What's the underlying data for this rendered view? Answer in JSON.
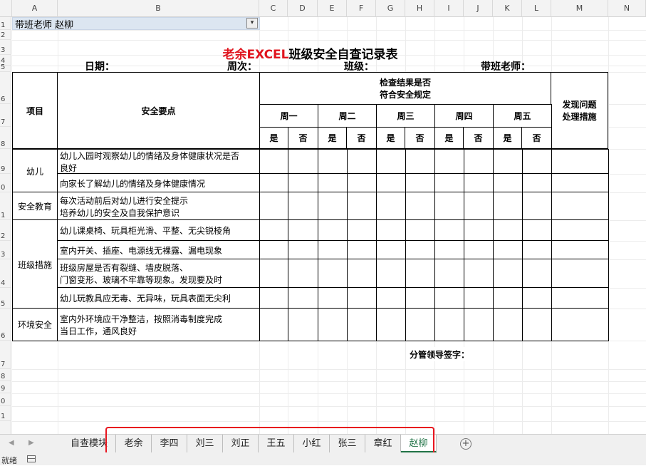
{
  "columns": [
    "A",
    "B",
    "C",
    "D",
    "E",
    "F",
    "G",
    "H",
    "I",
    "J",
    "K",
    "L",
    "M",
    "N"
  ],
  "rows": [
    "1",
    "2",
    "3",
    "4",
    "5",
    "6",
    "7",
    "8",
    "9",
    "0",
    "1",
    "2",
    "3",
    "4",
    "5",
    "6",
    "7",
    "8",
    "9",
    "0",
    "1"
  ],
  "cell_a1": "带班老师 赵柳",
  "filter_glyph": "▾",
  "title_red": "老余EXCEL",
  "title_black": "班级安全自查记录表",
  "labels": {
    "date": "日期：",
    "week": "周次：",
    "class": "班级：",
    "teacher": "带班老师："
  },
  "headers": {
    "item": "项目",
    "key_points": "安全要点",
    "check_result": "检查结果是否\n符合安全规定",
    "findings": "发现问题\n处理措施",
    "days": [
      "周一",
      "周二",
      "周三",
      "周四",
      "周五"
    ],
    "yes": "是",
    "no": "否"
  },
  "sections": [
    {
      "name": "幼儿",
      "points": [
        "幼儿入园时观察幼儿的情绪及身体健康状况是否\n良好",
        "向家长了解幼儿的情绪及身体健康情况"
      ]
    },
    {
      "name": "安全教育",
      "points": [
        "每次活动前后对幼儿进行安全提示\n培养幼儿的安全及自我保护意识"
      ]
    },
    {
      "name": "班级措施",
      "points": [
        "幼儿课桌椅、玩具柜光滑、平整、无尖锐棱角",
        "室内开关、插座、电源线无裸露、漏电现象",
        "班级房屋是否有裂缝、墙皮脱落、\n门窗变形、玻璃不牢靠等现象。发现要及时",
        "幼儿玩教具应无毒、无异味，玩具表面无尖利"
      ]
    },
    {
      "name": "环境安全",
      "points": [
        "室内外环境应干净整洁，按照消毒制度完成\n当日工作，通风良好"
      ]
    }
  ],
  "signature_label": "分管领导签字：",
  "nav": {
    "prev": "◀",
    "next": "▶"
  },
  "tabs": [
    "自查模块",
    "老余",
    "李四",
    "刘三",
    "刘正",
    "王五",
    "小红",
    "张三",
    "章红",
    "赵柳"
  ],
  "active_tab": "赵柳",
  "add_sheet": "+",
  "status": "就绪",
  "colors": {
    "accent": "#217346",
    "title_red": "#e0141e",
    "highlight": "#e8141e",
    "a1_fill": "#dce6f1"
  }
}
